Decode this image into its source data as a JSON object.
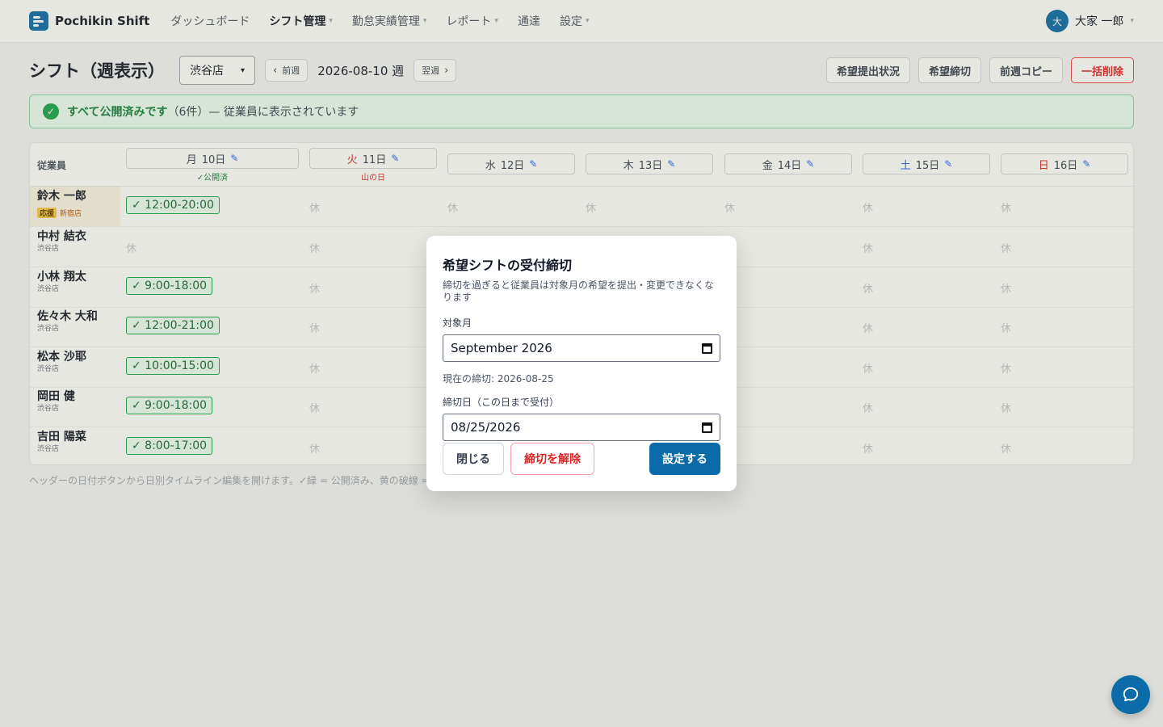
{
  "app": {
    "name": "Pochikin Shift"
  },
  "nav": {
    "items": [
      {
        "label": "ダッシュボード",
        "has_dropdown": false,
        "active": false
      },
      {
        "label": "シフト管理",
        "has_dropdown": true,
        "active": true
      },
      {
        "label": "勤怠実績管理",
        "has_dropdown": true,
        "active": false
      },
      {
        "label": "レポート",
        "has_dropdown": true,
        "active": false
      },
      {
        "label": "通達",
        "has_dropdown": false,
        "active": false
      },
      {
        "label": "設定",
        "has_dropdown": true,
        "active": false
      }
    ],
    "user": {
      "avatar_initial": "大",
      "name": "大家 一郎"
    }
  },
  "page": {
    "title": "シフト（週表示）",
    "store_select": "渋谷店",
    "prev_week": "前週",
    "week_label": "2026-08-10 週",
    "next_week": "翌週",
    "actions": {
      "requests_status": "希望提出状況",
      "request_deadline": "希望締切",
      "copy_prev_week": "前週コピー",
      "bulk_delete": "一括削除"
    }
  },
  "banner": {
    "bold": "すべて公開済みです",
    "count": "（6件）",
    "rest": " — 従業員に表示されています"
  },
  "grid": {
    "employee_header": "従業員",
    "days": [
      {
        "dow": "月",
        "date": "10日",
        "sub": "✓公開済",
        "sub_type": "published"
      },
      {
        "dow": "火",
        "date": "11日",
        "sub": "山の日",
        "sub_type": "holiday"
      },
      {
        "dow": "水",
        "date": "12日",
        "sub": "",
        "sub_type": ""
      },
      {
        "dow": "木",
        "date": "13日",
        "sub": "",
        "sub_type": ""
      },
      {
        "dow": "金",
        "date": "14日",
        "sub": "",
        "sub_type": ""
      },
      {
        "dow": "土",
        "date": "15日",
        "sub": "",
        "sub_type": ""
      },
      {
        "dow": "日",
        "date": "16日",
        "sub": "",
        "sub_type": ""
      }
    ],
    "rest_label": "休",
    "rows": [
      {
        "name": "鈴木 一郎",
        "store": "",
        "help_tag": "応援",
        "help_store": "新宿店",
        "monday": "✓ 12:00-20:00"
      },
      {
        "name": "中村 結衣",
        "store": "渋谷店",
        "monday": ""
      },
      {
        "name": "小林 翔太",
        "store": "渋谷店",
        "monday": "✓ 9:00-18:00"
      },
      {
        "name": "佐々木 大和",
        "store": "渋谷店",
        "monday": "✓ 12:00-21:00"
      },
      {
        "name": "松本 沙耶",
        "store": "渋谷店",
        "monday": "✓ 10:00-15:00"
      },
      {
        "name": "岡田 健",
        "store": "渋谷店",
        "monday": "✓ 9:00-18:00"
      },
      {
        "name": "吉田 陽菜",
        "store": "渋谷店",
        "monday": "✓ 8:00-17:00"
      }
    ]
  },
  "hint": "ヘッダーの日付ボタンから日別タイムライン編集を開けます。✓緑 = 公開済み、黄の破線 =",
  "modal": {
    "title": "希望シフトの受付締切",
    "description": "締切を過ぎると従業員は対象月の希望を提出・変更できなくなります",
    "month_label": "対象月",
    "month_value": "September 2026",
    "current_deadline": "現在の締切: 2026-08-25",
    "deadline_label": "締切日（この日まで受付）",
    "deadline_value": "08/25/2026",
    "close": "閉じる",
    "release": "締切を解除",
    "set": "設定する"
  },
  "colors": {
    "brand": "#0b6aa8",
    "success": "#16a34a",
    "danger": "#dc2626"
  }
}
